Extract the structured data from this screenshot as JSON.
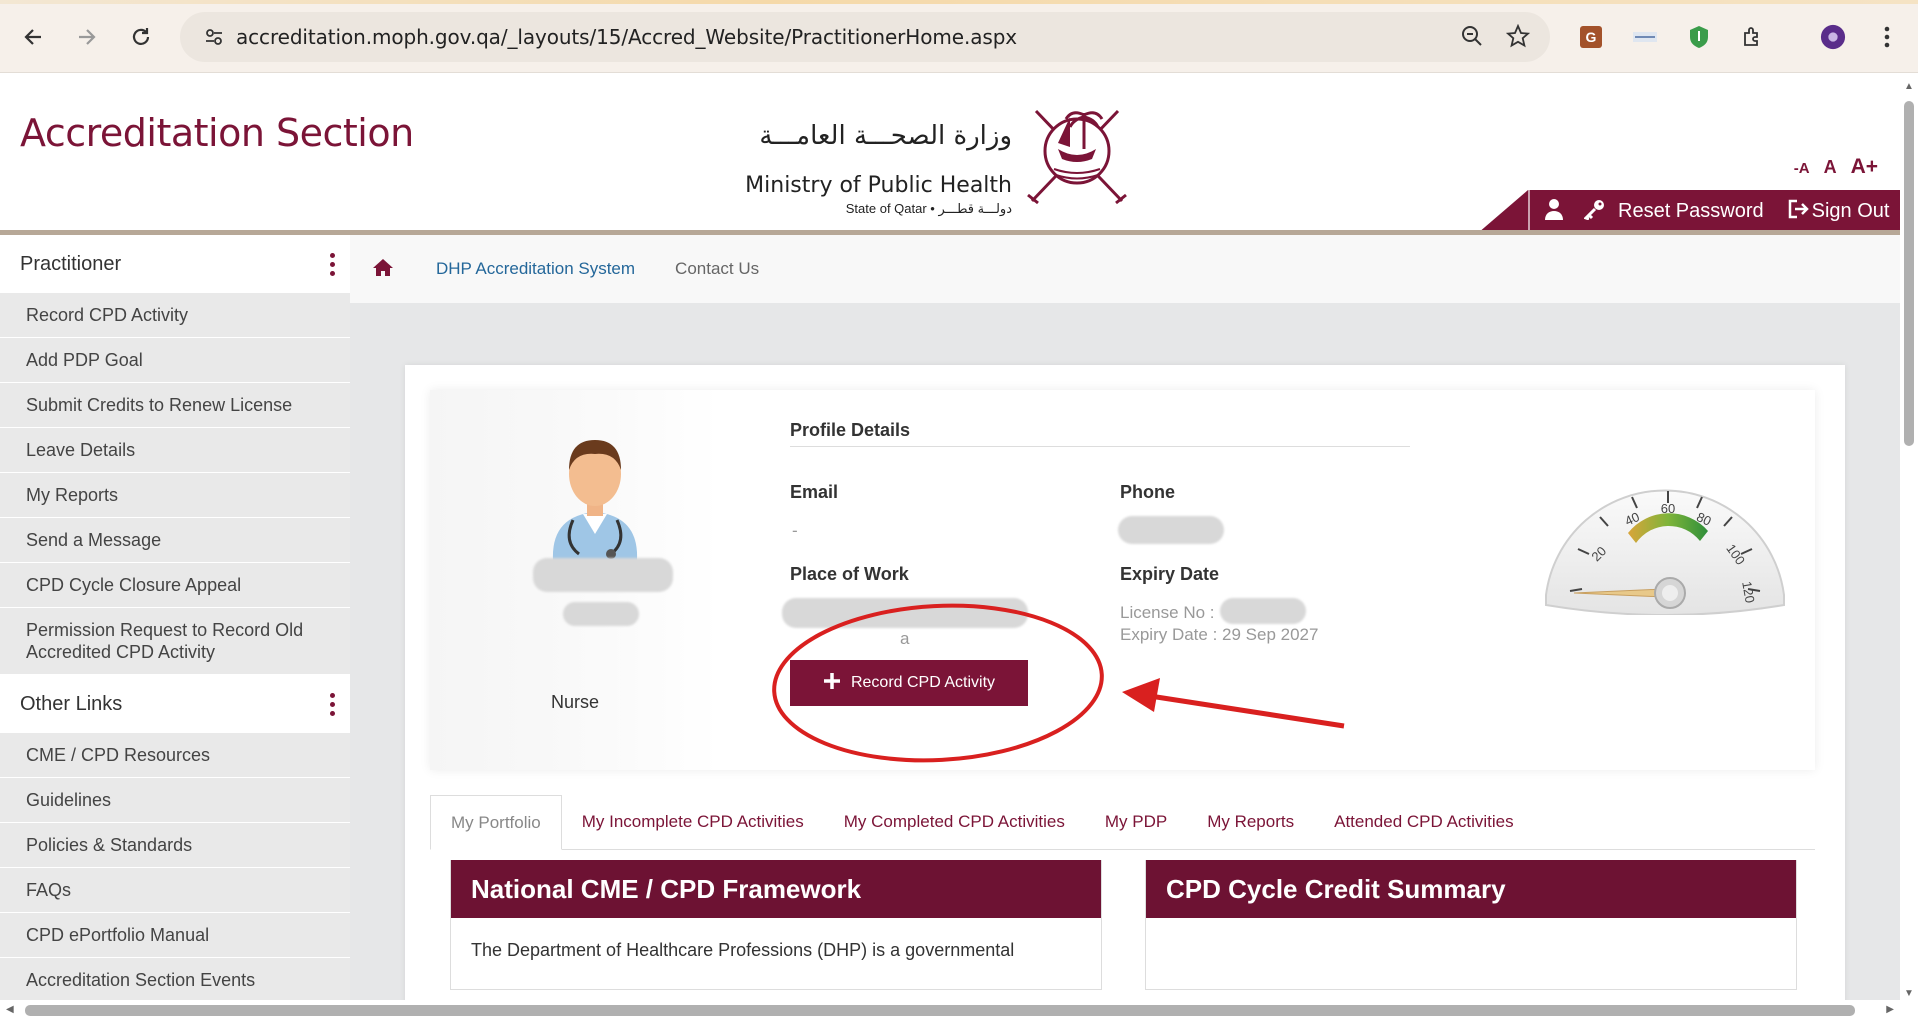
{
  "browser": {
    "url": "accreditation.moph.gov.qa/_layouts/15/Accred_Website/PractitionerHome.aspx"
  },
  "header": {
    "site_title": "Accreditation Section",
    "ministry_ar": "وزارة الصحـــة العامـــة",
    "ministry_en": "Ministry of Public Health",
    "ministry_sub": "State of Qatar • دولـــة قطـــر",
    "font_small": "-A",
    "font_normal": "A",
    "font_large": "A+",
    "reset_password": "Reset Password",
    "sign_out": "Sign Out",
    "accent_color": "#7b1437"
  },
  "sidebar": {
    "section1_title": "Practitioner",
    "items1": [
      "Record CPD Activity",
      "Add PDP Goal",
      "Submit Credits to Renew License",
      "Leave Details",
      "My Reports",
      "Send a Message",
      "CPD Cycle Closure Appeal",
      "Permission Request to Record Old Accredited CPD Activity"
    ],
    "section2_title": "Other Links",
    "items2": [
      "CME / CPD Resources",
      "Guidelines",
      "Policies & Standards",
      "FAQs",
      "CPD ePortfolio Manual",
      "Accreditation Section Events"
    ]
  },
  "breadcrumb": {
    "system": "DHP Accreditation System",
    "contact": "Contact Us"
  },
  "profile": {
    "title": "Profile Details",
    "role": "Nurse",
    "email_label": "Email",
    "email_value": "-",
    "phone_label": "Phone",
    "place_label": "Place of Work",
    "place_value_suffix": "a",
    "expiry_label": "Expiry Date",
    "license_no": "License No :",
    "expiry_date": "Expiry Date : 29 Sep 2027",
    "record_button": "Record CPD Activity",
    "gauge_ticks": [
      "20",
      "40",
      "60",
      "80",
      "100",
      "120"
    ]
  },
  "tabs": [
    "My Portfolio",
    "My Incomplete CPD Activities",
    "My Completed CPD Activities",
    "My PDP",
    "My Reports",
    "Attended CPD Activities"
  ],
  "panels": {
    "left_title": "National CME / CPD Framework",
    "left_body": "The Department of Healthcare Professions (DHP) is a governmental",
    "right_title": "CPD Cycle Credit Summary"
  }
}
